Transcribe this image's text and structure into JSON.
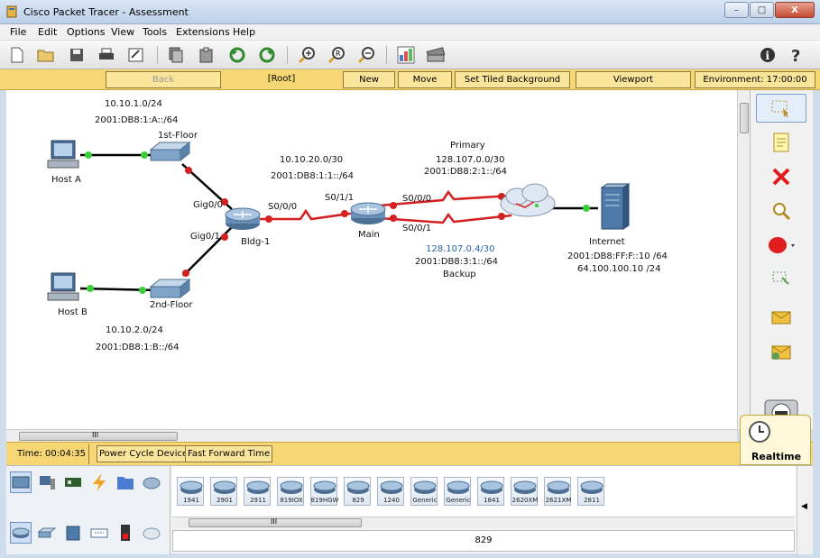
{
  "window": {
    "title": "Cisco Packet Tracer - Assessment",
    "buttons": {
      "minimize": "–",
      "maximize": "□",
      "close": "X"
    }
  },
  "menu": [
    "File",
    "Edit",
    "Options",
    "View",
    "Tools",
    "Extensions",
    "Help"
  ],
  "nav": {
    "back": "Back",
    "root": "[Root]",
    "new_cluster": "New Cluster",
    "move_object": "Move Object",
    "set_tiled_background": "Set Tiled Background",
    "viewport": "Viewport",
    "environment": "Environment: 17:00:00"
  },
  "topology": {
    "lan_a_net": "10.10.1.0/24",
    "lan_a_v6": "2001:DB8:1:A::/64",
    "floor1": "1st-Floor",
    "host_a": "Host A",
    "gig00": "Gig0/0",
    "gig01": "Gig0/1",
    "bldg1": "Bldg-1",
    "s000_b": "S0/0/0",
    "link_net": "10.10.20.0/30",
    "link_v6": "2001:DB8:1:1::/64",
    "s011": "S0/1/1",
    "main": "Main",
    "primary": "Primary",
    "primary_net": "128.107.0.0/30",
    "primary_v6": "2001:DB8:2:1::/64",
    "s000_m": "S0/0/0",
    "s001_m": "S0/0/1",
    "backup_net": "128.107.0.4/30",
    "backup_v6": "2001:DB8:3:1::/64",
    "backup": "Backup",
    "internet": "Internet",
    "internet_v6": "2001:DB8:FF:F::10 /64",
    "internet_v4": "64.100.100.10 /24",
    "host_b": "Host B",
    "floor2": "2nd-Floor",
    "lan_b_net": "10.10.2.0/24",
    "lan_b_v6": "2001:DB8:1:B::/64"
  },
  "scroll": {
    "hmark": "III",
    "dev_hmark": "III"
  },
  "timebar": {
    "time": "Time: 00:04:35",
    "power_cycle": "Power Cycle Devices",
    "fast_forward": "Fast Forward Time",
    "mode": "Realtime"
  },
  "devices": [
    "1941",
    "2901",
    "2911",
    "819IOX",
    "819HGW",
    "829",
    "1240",
    "Generic",
    "Generic",
    "1841",
    "2620XM",
    "2621XM",
    "2811"
  ],
  "selected_device": "829",
  "colors": {
    "serial_link": "#d42020",
    "ethernet_link": "#000000",
    "link_up": "#3ccd3c",
    "link_down": "#d42020",
    "navbar": "#f7d774"
  }
}
